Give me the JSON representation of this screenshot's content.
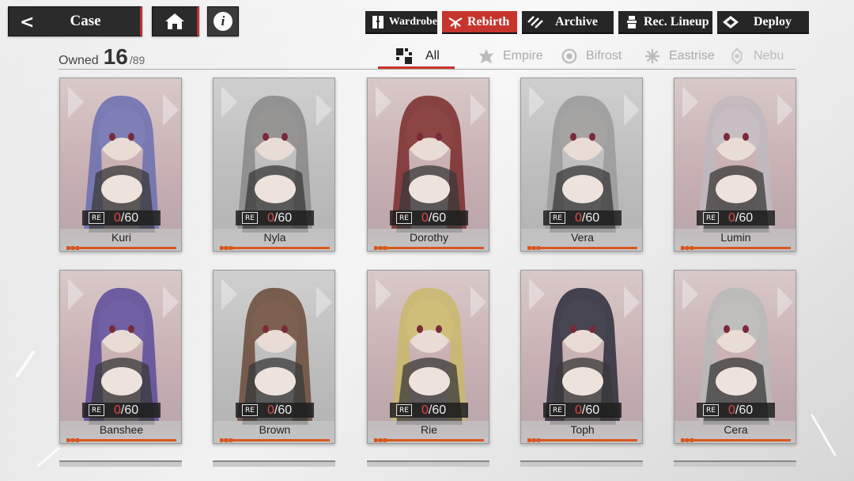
{
  "header": {
    "back_label": "Case",
    "nav": [
      {
        "label": "Wardrobe",
        "icon": "wardrobe-icon",
        "active": false
      },
      {
        "label": "Rebirth",
        "icon": "rebirth-icon",
        "active": true
      },
      {
        "label": "Archive",
        "icon": "archive-icon",
        "active": false
      },
      {
        "label": "Rec. Lineup",
        "icon": "lineup-icon",
        "active": false
      },
      {
        "label": "Deploy",
        "icon": "deploy-icon",
        "active": false
      }
    ]
  },
  "owned": {
    "label": "Owned",
    "count": "16",
    "total": "/89"
  },
  "filters": [
    {
      "label": "All",
      "active": true
    },
    {
      "label": "Empire",
      "active": false
    },
    {
      "label": "Bifrost",
      "active": false
    },
    {
      "label": "Eastrise",
      "active": false
    },
    {
      "label": "Nebu",
      "active": false
    }
  ],
  "cards": [
    {
      "name": "Kuri",
      "current": "0",
      "max": "/60"
    },
    {
      "name": "Nyla",
      "current": "0",
      "max": "/60"
    },
    {
      "name": "Dorothy",
      "current": "0",
      "max": "/60"
    },
    {
      "name": "Vera",
      "current": "0",
      "max": "/60"
    },
    {
      "name": "Lumin",
      "current": "0",
      "max": "/60"
    },
    {
      "name": "Banshee",
      "current": "0",
      "max": "/60"
    },
    {
      "name": "Brown",
      "current": "0",
      "max": "/60"
    },
    {
      "name": "Rie",
      "current": "0",
      "max": "/60"
    },
    {
      "name": "Toph",
      "current": "0",
      "max": "/60"
    },
    {
      "name": "Cera",
      "current": "0",
      "max": "/60"
    }
  ],
  "colors": {
    "accent": "#c6352d",
    "exp": "#d7581f",
    "count_current": "#e04848"
  }
}
